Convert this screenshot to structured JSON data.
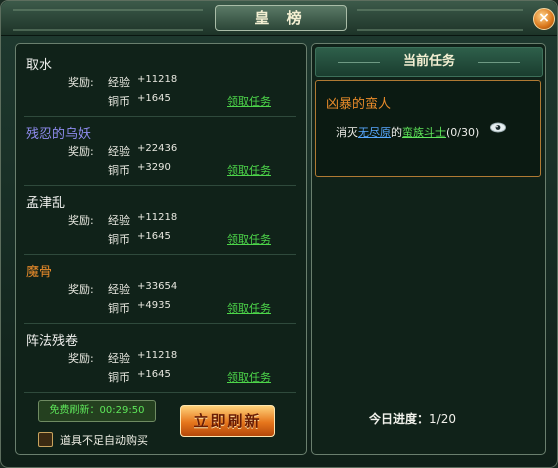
{
  "window": {
    "title": "皇 榜",
    "close_glyph": "×"
  },
  "tasks": [
    {
      "name": "取水",
      "name_color": "#f0f0ee",
      "reward_label": "奖励:",
      "exp_label": "经验",
      "exp": "+11218",
      "coin_label": "铜币",
      "coin": "+1645",
      "accept": "领取任务"
    },
    {
      "name": "残忍的乌妖",
      "name_color": "#8f8cf0",
      "reward_label": "奖励:",
      "exp_label": "经验",
      "exp": "+22436",
      "coin_label": "铜币",
      "coin": "+3290",
      "accept": "领取任务"
    },
    {
      "name": "孟津乱",
      "name_color": "#f0f0ee",
      "reward_label": "奖励:",
      "exp_label": "经验",
      "exp": "+11218",
      "coin_label": "铜币",
      "coin": "+1645",
      "accept": "领取任务"
    },
    {
      "name": "魔骨",
      "name_color": "#e98b2a",
      "reward_label": "奖励:",
      "exp_label": "经验",
      "exp": "+33654",
      "coin_label": "铜币",
      "coin": "+4935",
      "accept": "领取任务"
    },
    {
      "name": "阵法残卷",
      "name_color": "#f0f0ee",
      "reward_label": "奖励:",
      "exp_label": "经验",
      "exp": "+11218",
      "coin_label": "铜币",
      "coin": "+1645",
      "accept": "领取任务"
    }
  ],
  "free_refresh": "免费刷新：00:29:50",
  "refresh_button": "立即刷新",
  "auto_buy_label": "道具不足自动购买",
  "auto_buy_checked": false,
  "current": {
    "header": "当前任务",
    "quest_name": "凶暴的蛮人",
    "desc_prefix": "消灭",
    "desc_place": "无尽原",
    "desc_mid": "的",
    "desc_target": "蛮族斗士",
    "desc_count": "(0/30)"
  },
  "today_label": "今日进度：",
  "today_value": "1/20"
}
